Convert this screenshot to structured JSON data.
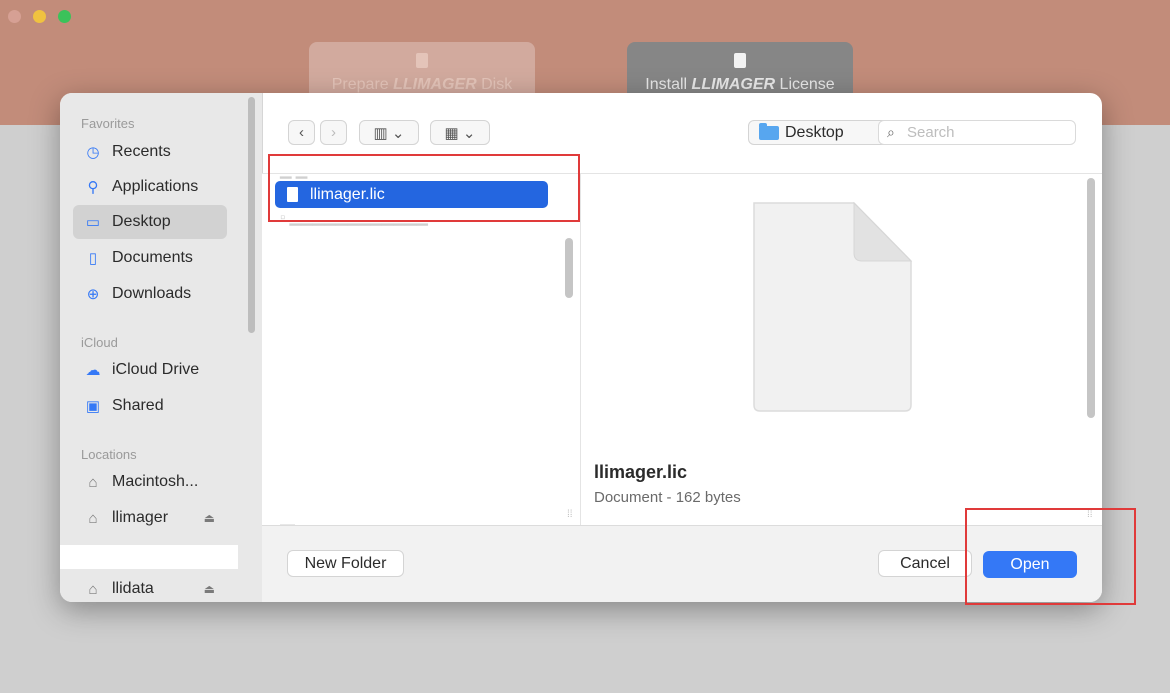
{
  "window": {
    "app_buttons": [
      {
        "label_prefix": "Prepare ",
        "label_bold": "LLIMAGER",
        "label_suffix": " Disk"
      },
      {
        "label_prefix": "Install ",
        "label_bold": "LLIMAGER",
        "label_suffix": " License"
      }
    ]
  },
  "sidebar": {
    "favorites_header": "Favorites",
    "favorites": [
      {
        "label": "Recents",
        "icon": "clock-icon",
        "selected": false
      },
      {
        "label": "Applications",
        "icon": "applications-icon",
        "selected": false
      },
      {
        "label": "Desktop",
        "icon": "desktop-icon",
        "selected": true
      },
      {
        "label": "Documents",
        "icon": "document-icon",
        "selected": false
      },
      {
        "label": "Downloads",
        "icon": "download-icon",
        "selected": false
      }
    ],
    "icloud_header": "iCloud",
    "icloud": [
      {
        "label": "iCloud Drive",
        "icon": "cloud-icon"
      },
      {
        "label": "Shared",
        "icon": "shared-folder-icon"
      }
    ],
    "locations_header": "Locations",
    "locations": [
      {
        "label": "Macintosh...",
        "icon": "disk-icon"
      },
      {
        "label": "llimager",
        "icon": "disk-icon",
        "eject": true
      },
      {
        "label": "llidata",
        "icon": "disk-icon",
        "eject": true
      }
    ]
  },
  "toolbar": {
    "location": "Desktop",
    "search_placeholder": "Search"
  },
  "file_list": {
    "selected_file": "llimager.lic"
  },
  "preview": {
    "name": "llimager.lic",
    "meta": "Document - 162 bytes"
  },
  "buttons": {
    "new_folder": "New Folder",
    "cancel": "Cancel",
    "open": "Open"
  },
  "colors": {
    "accent": "#3478f6",
    "selection": "#2466e0",
    "highlight": "#e03a3a",
    "app_header": "#c28c7a"
  }
}
